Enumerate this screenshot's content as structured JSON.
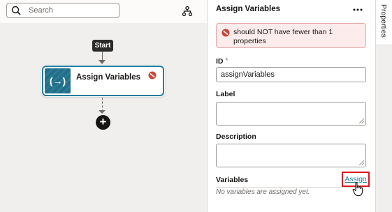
{
  "canvas": {
    "search_placeholder": "Search",
    "start_label": "Start",
    "node": {
      "title": "Assign Variables",
      "icon_symbol": "(→)"
    },
    "add_symbol": "+"
  },
  "panel": {
    "title": "Assign Variables",
    "error_message": "should NOT have fewer than 1 properties",
    "id_label": "ID",
    "id_required": "*",
    "id_value": "assignVariables",
    "label_label": "Label",
    "label_value": "",
    "description_label": "Description",
    "description_value": "",
    "variables_label": "Variables",
    "assign_link": "Assign",
    "no_variables_text": "No variables are assigned yet."
  },
  "rail": {
    "tab_label": "Properties"
  },
  "colors": {
    "accent": "#227e9e",
    "error": "#c74634",
    "highlight": "#e0141e"
  }
}
